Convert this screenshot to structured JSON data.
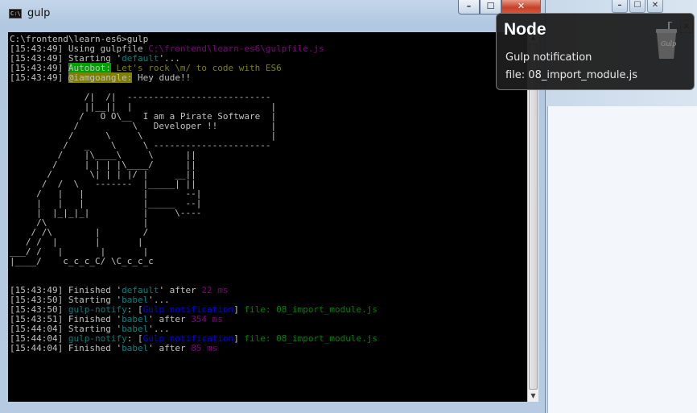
{
  "window": {
    "title": "gulp",
    "icon": "console-icon",
    "controls": {
      "minimize": "–",
      "maximize": "☐",
      "close": "✕"
    }
  },
  "background_window": {
    "controls": [
      "–",
      "☐",
      "✕"
    ],
    "close_glyph": "x"
  },
  "terminal": {
    "lines": [
      [
        [
          "gy",
          "C:\\frontend\\learn-es6>gulp"
        ]
      ],
      [
        [
          "gy",
          "[15:43:49] Using gulpfile "
        ],
        [
          "mg",
          "C:\\frontend\\learn-es6\\gulpfile.js"
        ]
      ],
      [
        [
          "gy",
          "[15:43:49] Starting '"
        ],
        [
          "cy",
          "default"
        ],
        [
          "gy",
          "'..."
        ]
      ],
      [
        [
          "gy",
          "[15:43:49] "
        ],
        [
          "hl-green",
          "Autobot:"
        ],
        [
          "ol",
          " Let's rock \\m/ to code with ES6"
        ]
      ],
      [
        [
          "gy",
          "[15:43:49] "
        ],
        [
          "hl-olive",
          "@iamgoangle:"
        ],
        [
          "gy",
          " Hey dude!!"
        ]
      ],
      [
        [
          "gy",
          ""
        ]
      ],
      [
        [
          "gy",
          "              /|  /|  ---------------------------"
        ]
      ],
      [
        [
          "gy",
          "              ||__||  |                          |"
        ]
      ],
      [
        [
          "gy",
          "             /   O O\\__  I am a Pirate Software  |"
        ]
      ],
      [
        [
          "gy",
          "            /          \\   Developer !!          |"
        ]
      ],
      [
        [
          "gy",
          "           /      \\     \\                        |"
        ]
      ],
      [
        [
          "gy",
          "          /   _    \\     \\ ----------------------"
        ]
      ],
      [
        [
          "gy",
          "         /    |\\____\\     \\      ||"
        ]
      ],
      [
        [
          "gy",
          "        /     | | | |\\____/      ||"
        ]
      ],
      [
        [
          "gy",
          "       /       \\| | | |/ |     __||"
        ]
      ],
      [
        [
          "gy",
          "      /  /  \\   -------  |_____| ||"
        ]
      ],
      [
        [
          "gy",
          "     /   |   |           |       --|"
        ]
      ],
      [
        [
          "gy",
          "     |   |   |           |_____  --|"
        ]
      ],
      [
        [
          "gy",
          "     |  |_|_|_|          |     \\----"
        ]
      ],
      [
        [
          "gy",
          "     /\\                  |"
        ]
      ],
      [
        [
          "gy",
          "    / /\\        |        /"
        ]
      ],
      [
        [
          "gy",
          "   / /  |       |       |"
        ]
      ],
      [
        [
          "gy",
          "___/ /   |       |       |"
        ]
      ],
      [
        [
          "gy",
          "|____/    c_c_c_C/ \\C_c_c_c"
        ]
      ],
      [
        [
          "gy",
          ""
        ]
      ],
      [
        [
          "gy",
          ""
        ]
      ],
      [
        [
          "gy",
          "[15:43:49] Finished '"
        ],
        [
          "cy",
          "default"
        ],
        [
          "gy",
          "' after "
        ],
        [
          "mg",
          "22 ms"
        ]
      ],
      [
        [
          "gy",
          "[15:43:50] Starting '"
        ],
        [
          "cy",
          "babel"
        ],
        [
          "gy",
          "'..."
        ]
      ],
      [
        [
          "gy",
          "[15:43:50] "
        ],
        [
          "cy",
          "gulp-notify"
        ],
        [
          "gy",
          ": ["
        ],
        [
          "bl",
          "Gulp notification"
        ],
        [
          "gy",
          "] "
        ],
        [
          "gr",
          "file: 08_import_module.js"
        ]
      ],
      [
        [
          "gy",
          "[15:43:51] Finished '"
        ],
        [
          "cy",
          "babel"
        ],
        [
          "gy",
          "' after "
        ],
        [
          "mg",
          "354 ms"
        ]
      ],
      [
        [
          "gy",
          "[15:44:04] Starting '"
        ],
        [
          "cy",
          "babel"
        ],
        [
          "gy",
          "'..."
        ]
      ],
      [
        [
          "gy",
          "[15:44:04] "
        ],
        [
          "cy",
          "gulp-notify"
        ],
        [
          "gy",
          ": ["
        ],
        [
          "bl",
          "Gulp notification"
        ],
        [
          "gy",
          "] "
        ],
        [
          "gr",
          "file: 08_import_module.js"
        ]
      ],
      [
        [
          "gy",
          "[15:44:04] Finished '"
        ],
        [
          "cy",
          "babel"
        ],
        [
          "gy",
          "' after "
        ],
        [
          "mg",
          "85 ms"
        ]
      ]
    ]
  },
  "notification": {
    "title": "Node",
    "message": "Gulp notification",
    "file_line": "file:  08_import_module.js",
    "icon": "gulp-cup-icon",
    "icon_text": "Gulp"
  },
  "colors": {
    "terminal_bg": "#000000",
    "text_gray": "#c0c0c0",
    "cyan": "#008080",
    "magenta": "#800080",
    "olive": "#808000",
    "green": "#008000",
    "blue": "#0000ee",
    "highlight_green": "#00a000",
    "highlight_olive": "#808000"
  }
}
